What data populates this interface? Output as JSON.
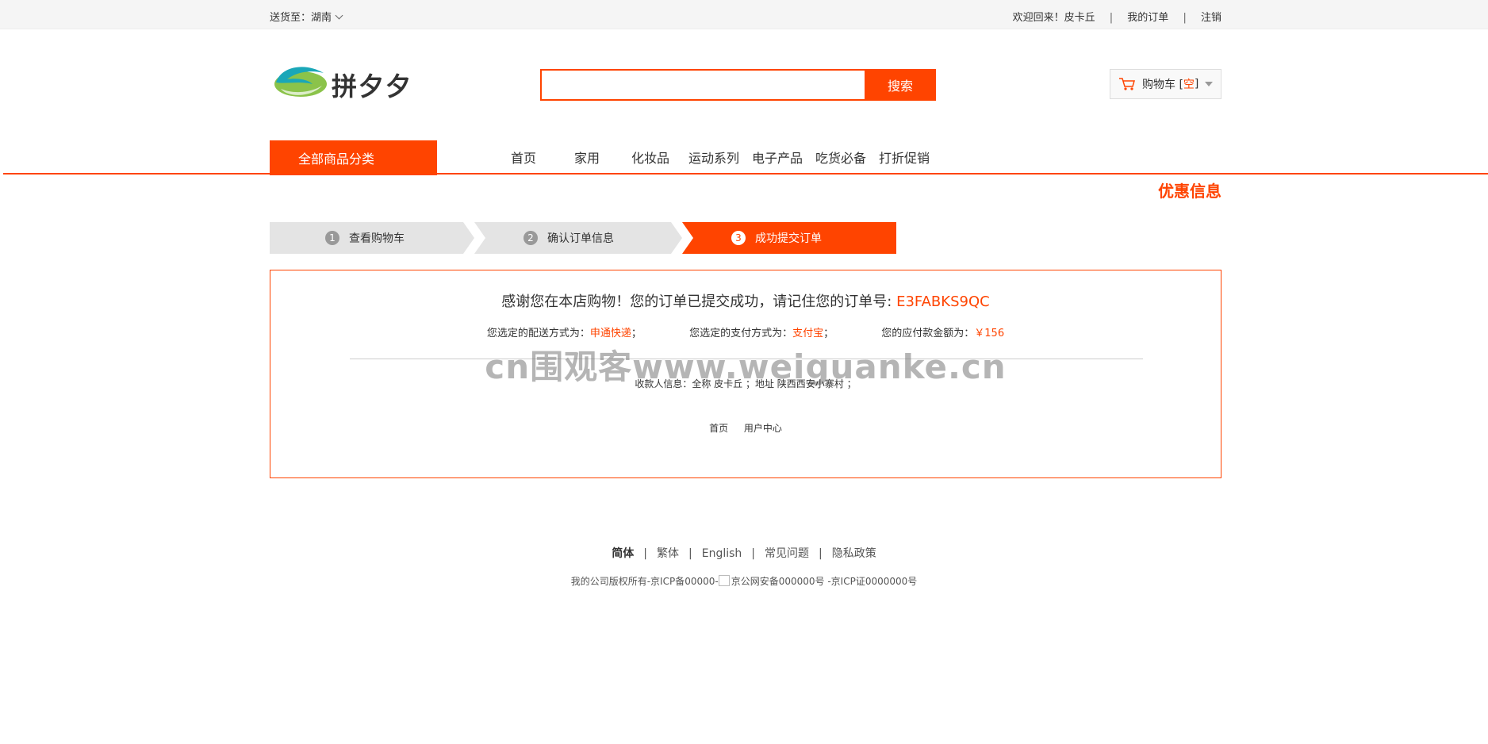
{
  "topbar": {
    "deliver_label": "送货至：湖南",
    "welcome": "欢迎回来！皮卡丘",
    "my_orders": "我的订单",
    "logout": "注销"
  },
  "header": {
    "logo_text": "拼夕夕",
    "search_placeholder": "",
    "search_button": "搜索",
    "cart_label": "购物车 [",
    "cart_status": "空",
    "cart_close": "]"
  },
  "nav": {
    "all_categories": "全部商品分类",
    "items": [
      "首页",
      "家用",
      "化妆品",
      "运动系列",
      "电子产品",
      "吃货必备",
      "打折促销"
    ],
    "promo": "优惠信息"
  },
  "steps": [
    {
      "num": "1",
      "label": "查看购物车"
    },
    {
      "num": "2",
      "label": "确认订单信息"
    },
    {
      "num": "3",
      "label": "成功提交订单"
    }
  ],
  "order": {
    "thanks": "感谢您在本店购物！您的订单已提交成功，请记住您的订单号: ",
    "order_no": "E3FABKS9QC",
    "shipping_label": "您选定的配送方式为：",
    "shipping_value": "申通快递",
    "payment_label": "您选定的支付方式为：",
    "payment_value": "支付宝",
    "amount_label": "您的应付款金额为：",
    "amount_value": "￥156",
    "semicolon": "；",
    "watermark": "cn围观客www.weiguanke.cn",
    "receiver": "收款人信息：全称  皮卡丘  ；地址  陕西西安小寨村  ；",
    "link_home": "首页",
    "link_user": "用户中心"
  },
  "footer": {
    "lang_simplified": "简体",
    "lang_traditional": "繁体",
    "lang_english": "English",
    "faq": "常见问题",
    "privacy": "隐私政策",
    "copyright_prefix": "我的公司版权所有-京ICP备00000-",
    "copyright_img_alt": "京公网安备000000号",
    "copyright_suffix": " -京ICP证0000000号"
  },
  "colors": {
    "accent": "#ff4400",
    "step_inactive": "#e4e4e4"
  }
}
